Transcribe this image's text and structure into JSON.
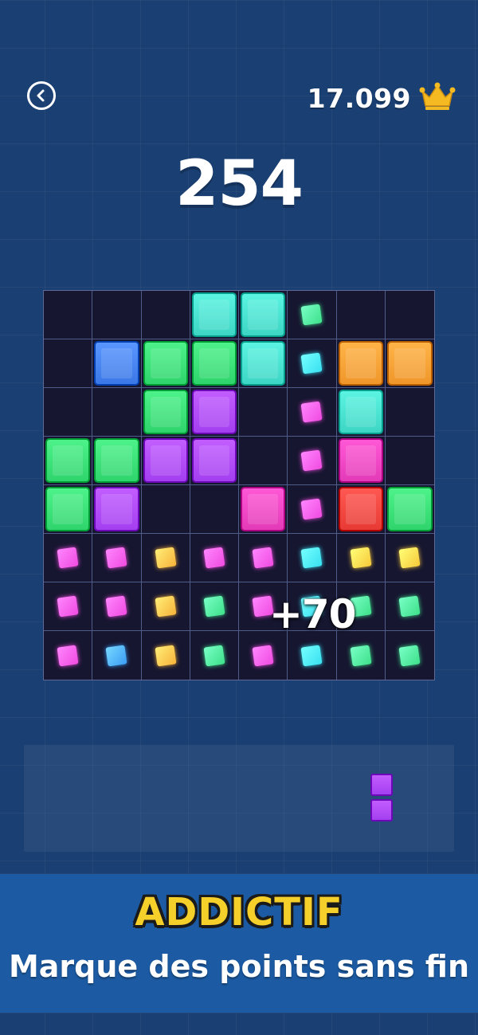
{
  "header": {
    "back_icon": "chevron-left-icon",
    "best_score": "17.099",
    "crown_icon": "crown-icon",
    "crown_color": "#f5b921"
  },
  "score": "254",
  "board": {
    "rows": 8,
    "cols": 8,
    "colors": {
      "teal": "#3dd6c4",
      "blue": "#3b78e7",
      "green": "#2fd46c",
      "orange": "#f0962a",
      "purple": "#a43ff0",
      "pink": "#e33ab8",
      "red": "#e83a34",
      "empty_cell": "#161630",
      "grid_line": "#4f5c8a"
    },
    "cells": [
      [
        "",
        "",
        "",
        "teal",
        "teal",
        "*green",
        "",
        ""
      ],
      [
        "",
        "blue",
        "green",
        "green",
        "teal",
        "*cyan",
        "orange",
        "orange"
      ],
      [
        "",
        "",
        "green",
        "purple",
        "",
        "*pink",
        "teal",
        ""
      ],
      [
        "green",
        "green",
        "purple",
        "purple",
        "",
        "*pink",
        "pink",
        ""
      ],
      [
        "green",
        "purple",
        "",
        "",
        "pink",
        "*pink",
        "red",
        "green"
      ],
      [
        "*pink",
        "*pink",
        "*orange",
        "*pink",
        "*pink",
        "*cyan",
        "*gold",
        "*gold"
      ],
      [
        "*pink",
        "*pink",
        "*orange",
        "*green",
        "*pink",
        "*cyan",
        "*green",
        "*green"
      ],
      [
        "*pink",
        "*blue",
        "*orange",
        "*green",
        "*pink",
        "*cyan",
        "*green",
        "*green"
      ]
    ],
    "sparkle_colors": {
      "green": "#3de08a",
      "cyan": "#38e0f0",
      "pink": "#f04ae0",
      "orange": "#f7b23a",
      "gold": "#f7c83a",
      "blue": "#3b9cf5"
    }
  },
  "points_popup": "+70",
  "tray": {
    "piece": {
      "color": "#a43ff0",
      "shape": "vertical-2"
    }
  },
  "banner": {
    "title": "ADDICTIF",
    "subtitle": "Marque des points sans fin",
    "background": "#1c5ba3"
  }
}
